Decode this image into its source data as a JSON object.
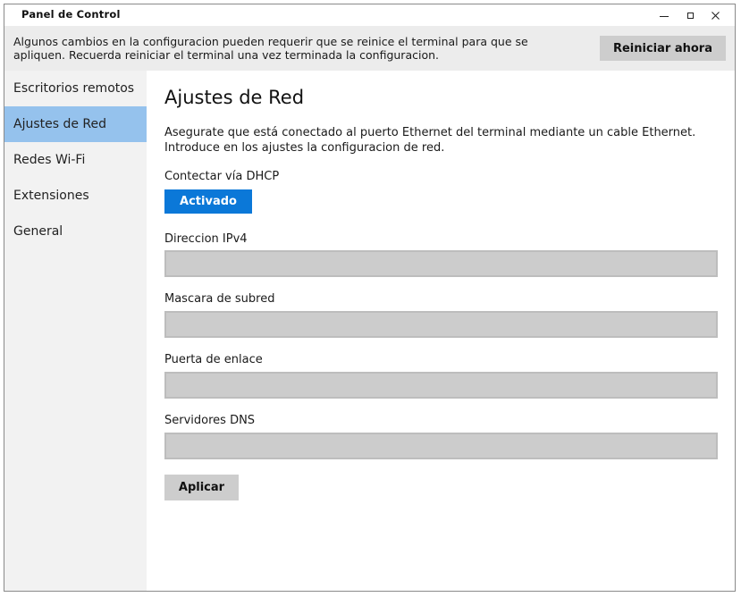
{
  "window": {
    "title": "Panel de Control"
  },
  "notice": {
    "text": "Algunos cambios en la configuracion pueden requerir que se reinice el terminal para que se apliquen. Recuerda reiniciar el terminal una vez terminada la configuracion.",
    "restart_button": "Reiniciar ahora"
  },
  "sidebar": {
    "items": [
      {
        "label": "Escritorios remotos",
        "active": false
      },
      {
        "label": "Ajustes de Red",
        "active": true
      },
      {
        "label": "Redes Wi-Fi",
        "active": false
      },
      {
        "label": "Extensiones",
        "active": false
      },
      {
        "label": "General",
        "active": false
      }
    ]
  },
  "main": {
    "title": "Ajustes de Red",
    "description": "Asegurate que está conectado al puerto Ethernet del terminal mediante un cable Ethernet. Introduce en los ajustes la configuracion de red.",
    "dhcp": {
      "label": "Contectar vía DHCP",
      "button": "Activado"
    },
    "fields": {
      "ipv4": {
        "label": "Direccion IPv4",
        "value": ""
      },
      "subnet": {
        "label": "Mascara de subred",
        "value": ""
      },
      "gateway": {
        "label": "Puerta de enlace",
        "value": ""
      },
      "dns": {
        "label": "Servidores DNS",
        "value": ""
      }
    },
    "apply_button": "Aplicar"
  },
  "colors": {
    "accent": "#0b78d8",
    "sidebar_active": "#95c2ed",
    "sidebar_bg": "#f2f2f2",
    "notice_bg": "#ececec",
    "input_bg": "#cccccc",
    "button_bg": "#cdcdcd"
  },
  "icons": {
    "minimize": "minimize-icon",
    "maximize": "maximize-icon",
    "close": "close-icon"
  }
}
